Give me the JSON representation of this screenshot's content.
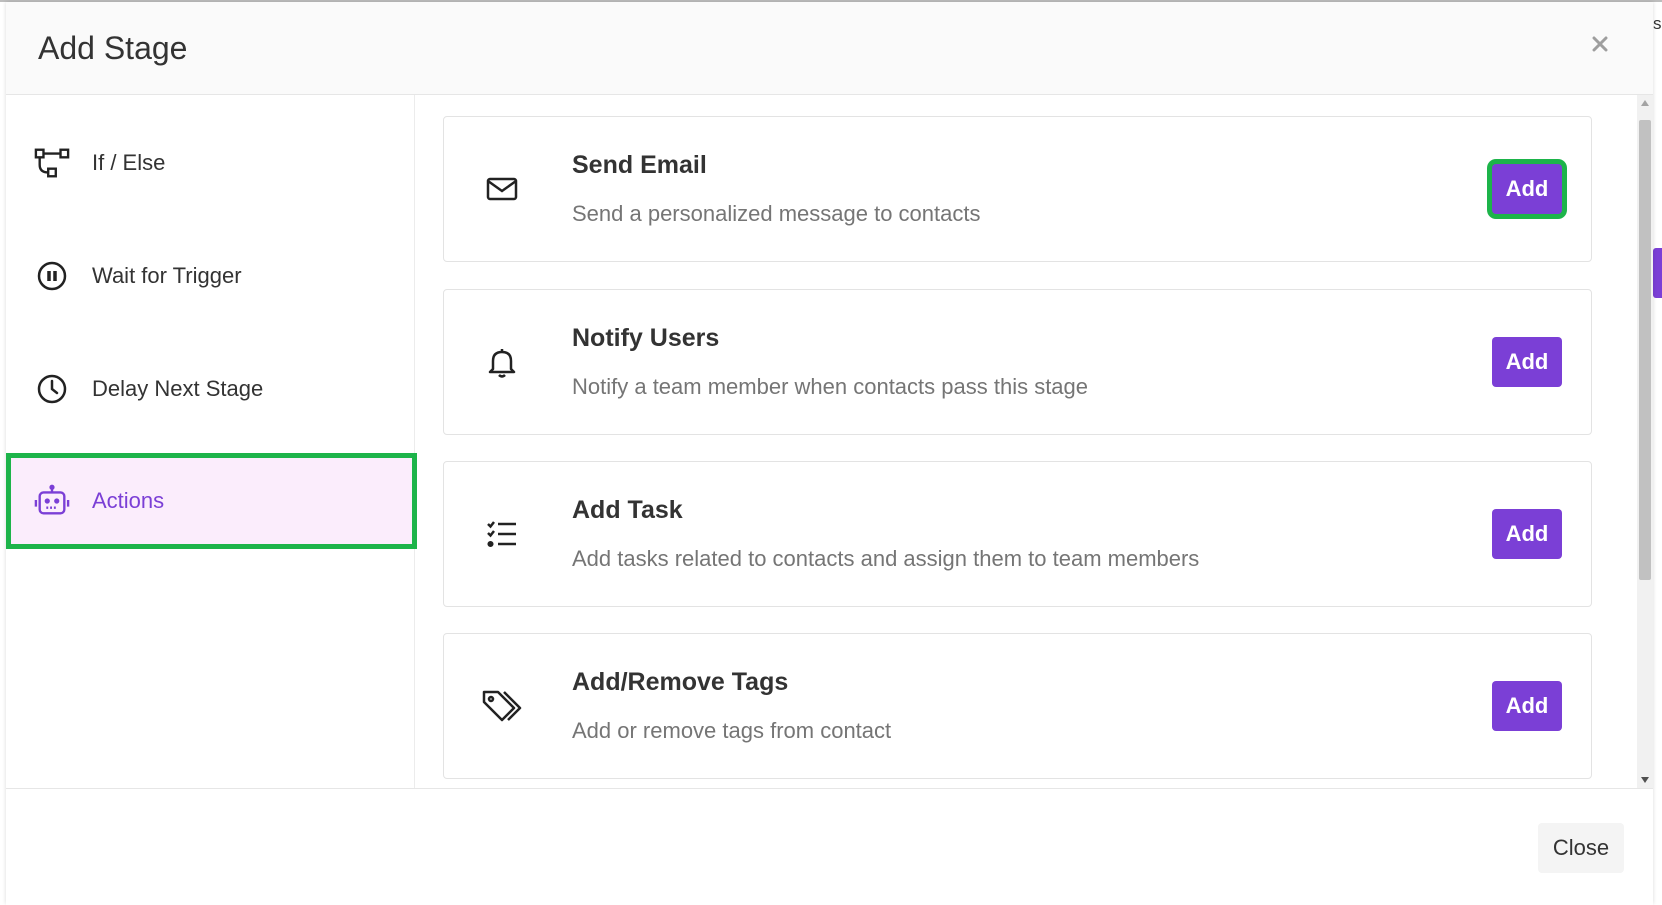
{
  "modal": {
    "title": "Add Stage"
  },
  "sidebar": {
    "items": [
      {
        "label": "If / Else",
        "icon": "branch-icon"
      },
      {
        "label": "Wait for Trigger",
        "icon": "pause-circle-icon"
      },
      {
        "label": "Delay Next Stage",
        "icon": "clock-icon"
      },
      {
        "label": "Actions",
        "icon": "robot-icon",
        "active": true
      }
    ]
  },
  "actions": [
    {
      "title": "Send Email",
      "description": "Send a personalized message to contacts",
      "icon": "envelope-icon",
      "button": "Add"
    },
    {
      "title": "Notify Users",
      "description": "Notify a team member when contacts pass this stage",
      "icon": "bell-icon",
      "button": "Add"
    },
    {
      "title": "Add Task",
      "description": "Add tasks related to contacts and assign them to team members",
      "icon": "checklist-icon",
      "button": "Add"
    },
    {
      "title": "Add/Remove Tags",
      "description": "Add or remove tags from contact",
      "icon": "tags-icon",
      "button": "Add"
    }
  ],
  "footer": {
    "close_label": "Close"
  },
  "edge": {
    "cut_letter": "s"
  },
  "colors": {
    "accent": "#7b3fd6",
    "highlight": "#1db44a",
    "active_bg": "#fbedfc"
  }
}
